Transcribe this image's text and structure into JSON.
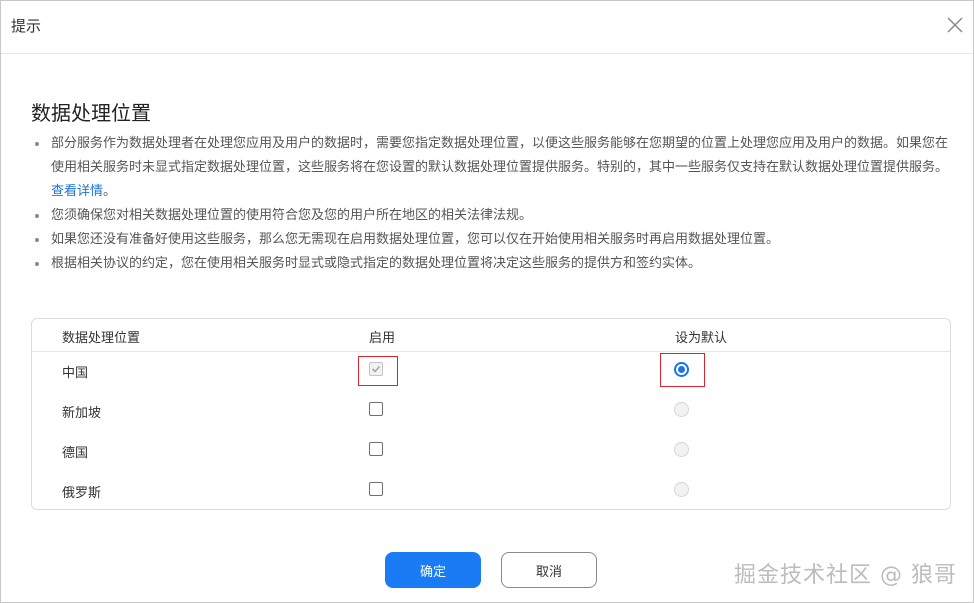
{
  "dialog": {
    "title": "提示",
    "close_icon": "close-icon"
  },
  "section": {
    "title": "数据处理位置",
    "notes": [
      {
        "text": "部分服务作为数据处理者在处理您应用及用户的数据时，需要您指定数据处理位置，以便这些服务能够在您期望的位置上处理您应用及用户的数据。如果您在使用相关服务时未显式指定数据处理位置，这些服务将在您设置的默认数据处理位置提供服务。特别的，其中一些服务仅支持在默认数据处理位置提供服务。",
        "link": "查看详情",
        "suffix": "。"
      },
      {
        "text": "您须确保您对相关数据处理位置的使用符合您及您的用户所在地区的相关法律法规。"
      },
      {
        "text": "如果您还没有准备好使用这些服务，那么您无需现在启用数据处理位置，您可以仅在开始使用相关服务时再启用数据处理位置。"
      },
      {
        "text": "根据相关协议的约定，您在使用相关服务时显式或隐式指定的数据处理位置将决定这些服务的提供方和签约实体。"
      }
    ]
  },
  "table": {
    "headers": {
      "location": "数据处理位置",
      "enable": "启用",
      "default": "设为默认"
    },
    "rows": [
      {
        "name": "中国",
        "enabled": true,
        "enabled_disabled": true,
        "is_default": true
      },
      {
        "name": "新加坡",
        "enabled": false,
        "is_default": false
      },
      {
        "name": "德国",
        "enabled": false,
        "is_default": false
      },
      {
        "name": "俄罗斯",
        "enabled": false,
        "is_default": false
      }
    ]
  },
  "footer": {
    "confirm_label": "确定",
    "cancel_label": "取消"
  },
  "watermark": "掘金技术社区 @ 狼哥",
  "colors": {
    "primary": "#1a7cf5",
    "link": "#1a73d9",
    "highlight_box": "#d9262c"
  }
}
